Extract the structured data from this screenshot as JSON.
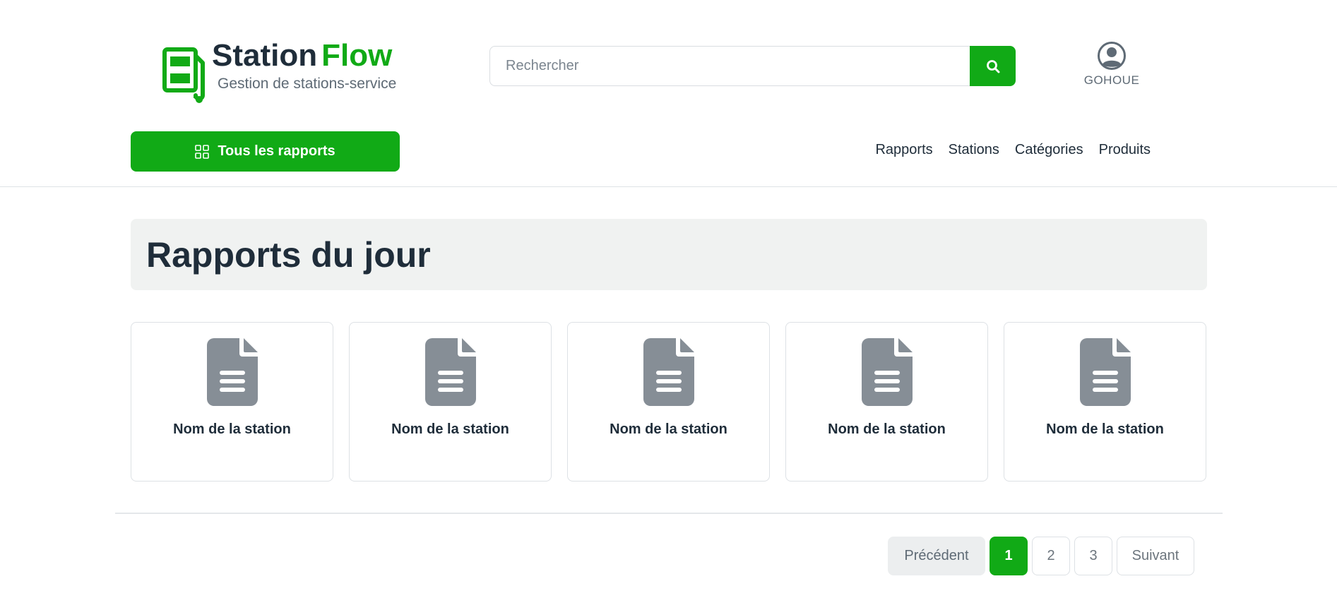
{
  "brand": {
    "name_part1": "Station",
    "name_part2": "Flow",
    "tagline": "Gestion de stations-service",
    "icon": "fuel-pump-icon"
  },
  "search": {
    "placeholder": "Rechercher",
    "value": "",
    "button_icon": "search-icon"
  },
  "user": {
    "name": "GOHOUE",
    "icon": "user-circle-icon"
  },
  "toolbar": {
    "all_reports_label": "Tous les rapports",
    "all_reports_icon": "grid-icon"
  },
  "nav": {
    "items": [
      {
        "label": "Rapports"
      },
      {
        "label": "Stations"
      },
      {
        "label": "Catégories"
      },
      {
        "label": "Produits"
      }
    ]
  },
  "main": {
    "title": "Rapports du jour",
    "cards": [
      {
        "label": "Nom de la station",
        "icon": "document-icon"
      },
      {
        "label": "Nom de la station",
        "icon": "document-icon"
      },
      {
        "label": "Nom de la station",
        "icon": "document-icon"
      },
      {
        "label": "Nom de la station",
        "icon": "document-icon"
      },
      {
        "label": "Nom de la station",
        "icon": "document-icon"
      }
    ]
  },
  "pagination": {
    "previous_label": "Précédent",
    "next_label": "Suivant",
    "pages": [
      "1",
      "2",
      "3"
    ],
    "current_page": "1"
  },
  "colors": {
    "accent": "#11aa16",
    "text_dark": "#1f2d3a",
    "text_muted": "#5e6a75",
    "icon_gray": "#868e96",
    "banner_bg": "#f0f2f1"
  }
}
